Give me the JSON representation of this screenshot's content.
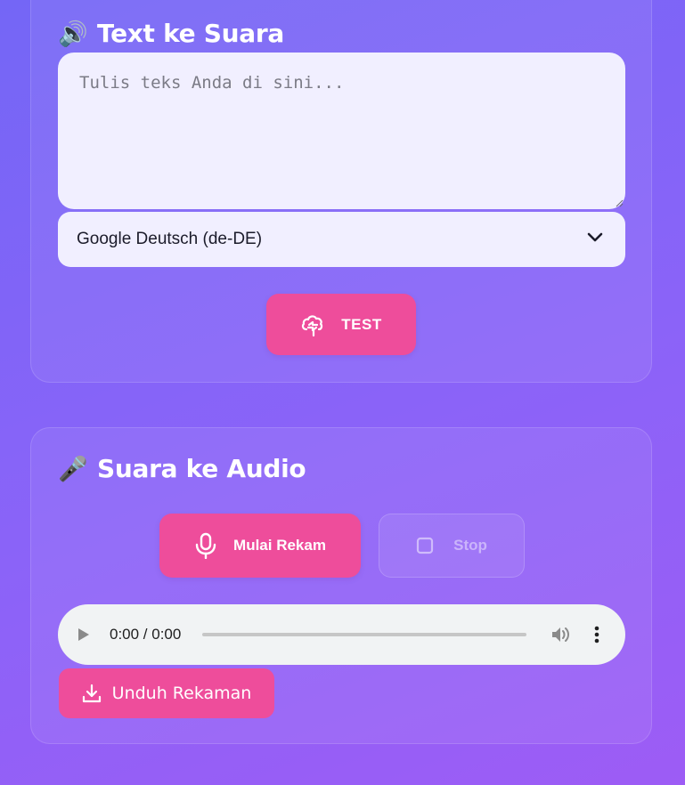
{
  "tts": {
    "emoji": "🔊",
    "title": "Text ke Suara",
    "textarea_value": "",
    "textarea_placeholder": "Tulis teks Anda di sini...",
    "voice_selected": "Google Deutsch (de-DE)",
    "test_label": "TEST",
    "test_icon": "cloud-refresh-icon"
  },
  "stt": {
    "emoji": "🎤",
    "title": "Suara ke Audio",
    "record_label": "Mulai Rekam",
    "record_icon": "microphone-icon",
    "stop_label": "Stop",
    "stop_icon": "stop-square-icon",
    "audio_time": "0:00 / 0:00",
    "audio_progress": 0,
    "download_label": "Unduh Rekaman",
    "download_icon": "download-icon"
  },
  "colors": {
    "accent_pink": "#ee4d9b",
    "background_start": "#7466f6",
    "background_end": "#9d5cf5",
    "input_background": "#f1efff"
  }
}
